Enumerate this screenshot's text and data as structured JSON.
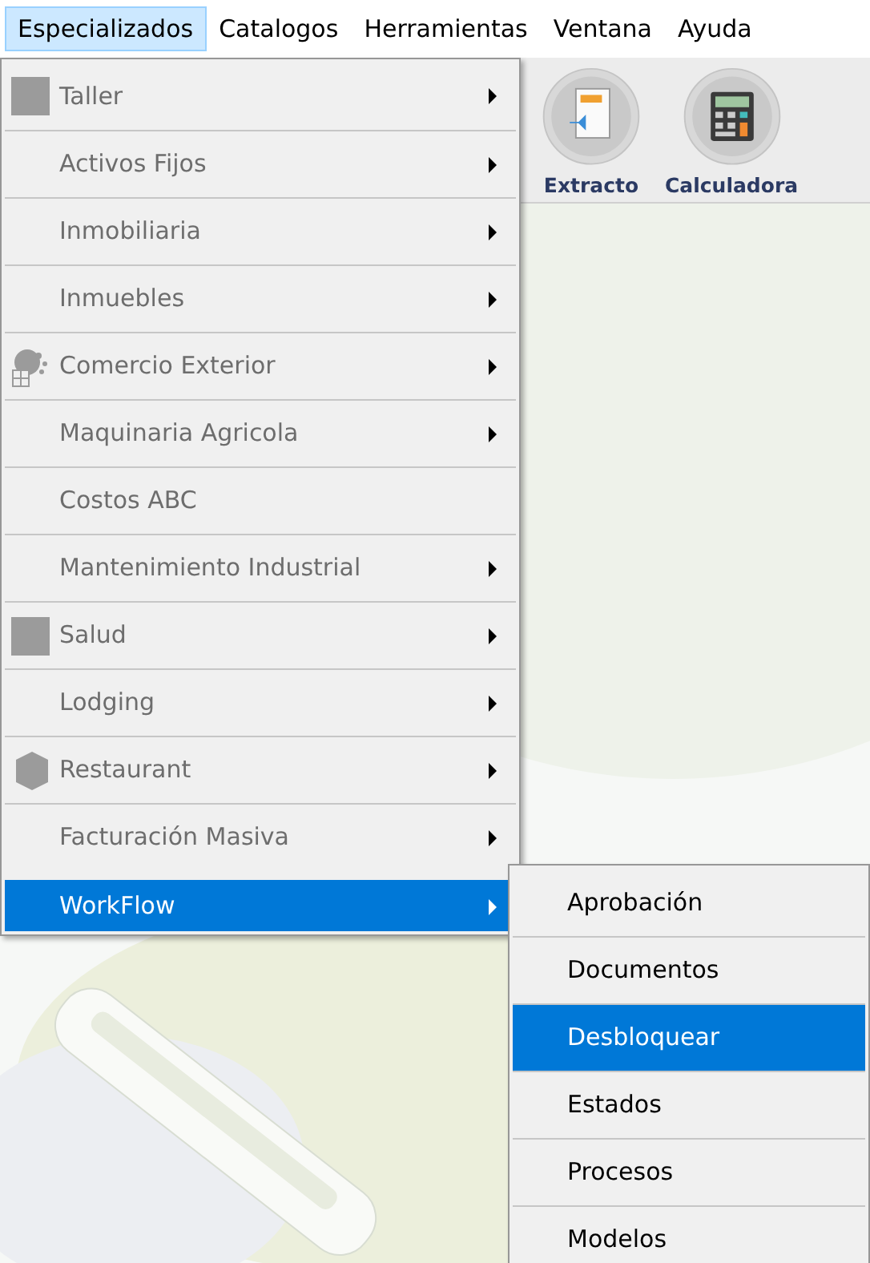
{
  "menu_bar": [
    {
      "label": "Especializados",
      "selected": true
    },
    {
      "label": "Catalogos",
      "selected": false
    },
    {
      "label": "Herramientas",
      "selected": false
    },
    {
      "label": "Ventana",
      "selected": false
    },
    {
      "label": "Ayuda",
      "selected": false
    }
  ],
  "toolbar": [
    {
      "label": "Extracto",
      "kind": "document"
    },
    {
      "label": "Calculadora",
      "kind": "calculator"
    }
  ],
  "menu": [
    {
      "label": "Taller",
      "kind": "square",
      "submenu": true,
      "selected": false
    },
    {
      "label": "Activos Fijos",
      "submenu": true,
      "selected": false
    },
    {
      "label": "Inmobiliaria",
      "submenu": true,
      "selected": false
    },
    {
      "label": "Inmuebles",
      "submenu": true,
      "selected": false
    },
    {
      "label": "Comercio Exterior",
      "kind": "gears",
      "submenu": true,
      "selected": false
    },
    {
      "label": "Maquinaria Agricola",
      "submenu": true,
      "selected": false
    },
    {
      "label": "Costos ABC",
      "submenu": false,
      "selected": false
    },
    {
      "label": "Mantenimiento Industrial",
      "submenu": true,
      "selected": false
    },
    {
      "label": "Salud",
      "kind": "square",
      "submenu": true,
      "selected": false
    },
    {
      "label": "Lodging",
      "submenu": true,
      "selected": false
    },
    {
      "label": "Restaurant",
      "kind": "hexagon",
      "submenu": true,
      "selected": false
    },
    {
      "label": "Facturación Masiva",
      "submenu": true,
      "selected": false
    },
    {
      "label": "WorkFlow",
      "submenu": true,
      "selected": true
    }
  ],
  "submenu": [
    {
      "label": "Aprobación",
      "selected": false
    },
    {
      "label": "Documentos",
      "selected": false
    },
    {
      "label": "Desbloquear",
      "selected": true
    },
    {
      "label": "Estados",
      "selected": false
    },
    {
      "label": "Procesos",
      "selected": false
    },
    {
      "label": "Modelos",
      "selected": false
    }
  ]
}
